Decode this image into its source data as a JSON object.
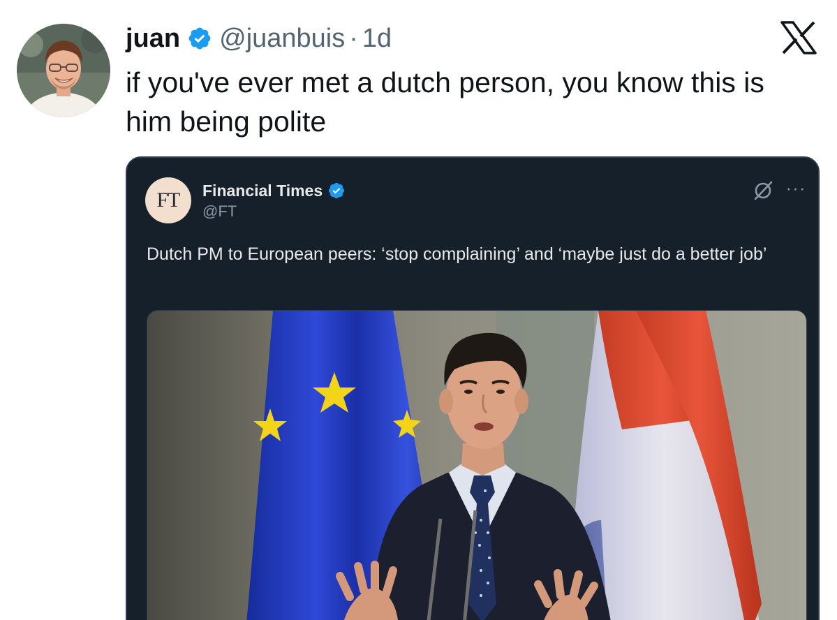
{
  "tweet": {
    "display_name": "juan",
    "handle": "@juanbuis",
    "separator": "·",
    "time": "1d",
    "text": "if you've ever met a dutch person, you know this is him being polite",
    "verified": true
  },
  "quoted_tweet": {
    "logo_text": "FT",
    "display_name": "Financial Times",
    "handle": "@FT",
    "text": "Dutch PM to European peers: ‘stop complaining’ and ‘maybe just do a better job’",
    "verified": true,
    "more_label": "···"
  },
  "icons": {
    "verified": "verified-badge-icon",
    "platform": "x-logo-icon",
    "grok": "grok-icon",
    "more": "more-icon"
  },
  "colors": {
    "verified_blue": "#1d9bf0",
    "quote_background": "#16202a",
    "text_primary": "#0f1419",
    "text_secondary": "#536471"
  }
}
